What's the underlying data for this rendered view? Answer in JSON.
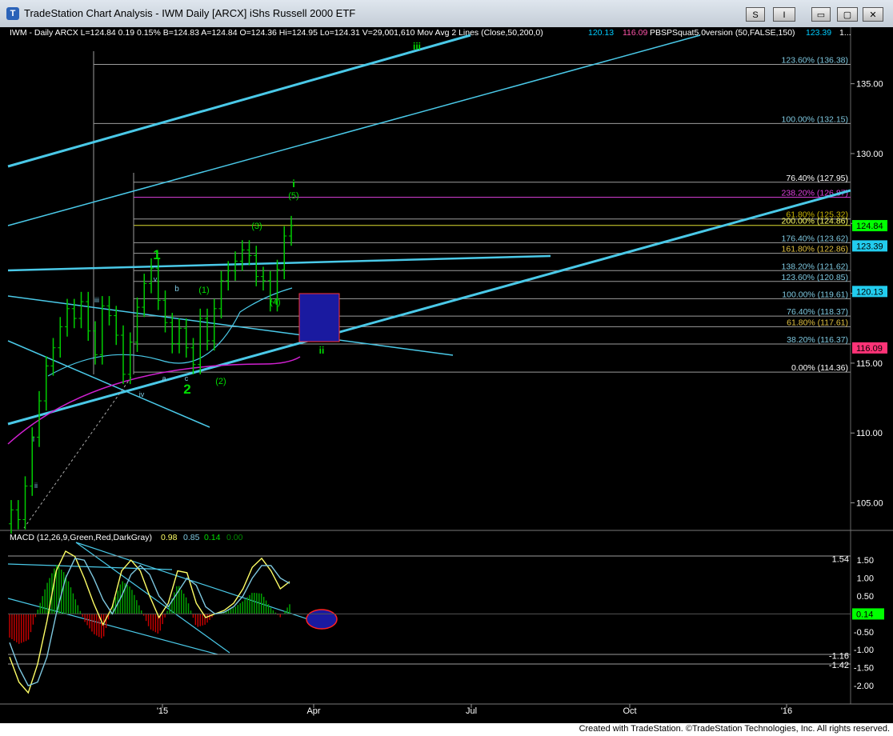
{
  "window": {
    "title": "TradeStation Chart Analysis - IWM Daily [ARCX] iShs Russell 2000 ETF",
    "btn_s": "S",
    "btn_i": "I",
    "btn_min": "▭",
    "btn_max": "▢",
    "btn_close": "✕"
  },
  "colors": {
    "price_up": "#00cc00",
    "channel": "#4ac9e8",
    "macd_hist_pos": "#00aa00",
    "macd_hist_neg": "#cc0000",
    "label_green": "#00dd00",
    "fib_line": "#9c9c9c"
  },
  "header": {
    "text": "IWM - Daily  ARCX  L=124.84  0.19  0.15%  B=124.83  A=124.84  O=124.36  Hi=124.95  Lo=124.31  V=29,001,610  Mov Avg 2 Lines (Close,50,200,0)",
    "ma_val1": "120.13",
    "ma_val2": "116.09",
    "indicator": "PBSPSquat5.0version (50,FALSE,150)",
    "ind_val": "123.39",
    "trail": "1..."
  },
  "chart_data": [
    {
      "type": "line",
      "title": "IWM Daily [ARCX] iShs Russell 2000 ETF",
      "x_ticks": [
        "'15",
        "Apr",
        "Jul",
        "Oct",
        "'16"
      ],
      "y_ticks": [
        "135.00",
        "130.00",
        "125.00",
        "120.00",
        "115.00",
        "110.00",
        "105.00"
      ],
      "ylim": [
        103.2,
        138.3
      ],
      "series": [
        {
          "name": "IWM",
          "style": "bars",
          "values": [
            104.5,
            103.8,
            106.2,
            109.7,
            112.3,
            114.8,
            116.1,
            117.6,
            118.9,
            118.2,
            119.4,
            117.3,
            115.6,
            119.1,
            118.4,
            117.0,
            114.2,
            116.5,
            119.0,
            120.7,
            121.8,
            119.5,
            117.9,
            116.4,
            117.5,
            116.1,
            114.9,
            118.2,
            116.6,
            118.9,
            120.9,
            121.6,
            122.3,
            123.1,
            122.7,
            121.2,
            120.9,
            119.4,
            121.7,
            124.1,
            124.84
          ]
        }
      ],
      "fib_levels": [
        {
          "label": "123.60% (136.38)",
          "value": 136.38
        },
        {
          "label": "100.00% (132.15)",
          "value": 132.15
        },
        {
          "label": "76.40% (127.95)",
          "value": 127.95
        },
        {
          "label": "238.20% (126.87)",
          "value": 126.87
        },
        {
          "label": "61.80% (125.32)",
          "value": 125.32
        },
        {
          "label": "200.00% (124.86)",
          "value": 124.86
        },
        {
          "label": "176.40% (123.62)",
          "value": 123.62
        },
        {
          "label": "161.80% (122.86)",
          "value": 122.86
        },
        {
          "label": "138.20% (121.62)",
          "value": 121.62
        },
        {
          "label": "123.60% (120.85)",
          "value": 120.85
        },
        {
          "label": "100.00% (119.61)",
          "value": 119.61
        },
        {
          "label": "76.40% (118.37)",
          "value": 118.37
        },
        {
          "label": "61.80% (117.61)",
          "value": 117.61
        },
        {
          "label": "38.20% (116.37)",
          "value": 116.37
        },
        {
          "label": "0.00% (114.36)",
          "value": 114.36
        }
      ],
      "wave_labels": [
        "iii",
        "i",
        "(5)",
        "(3)",
        "1",
        "(1)",
        "b",
        "(4)",
        "ii",
        "iii",
        "a",
        "c",
        "2",
        "(2)",
        "iv",
        "ii",
        "i",
        "v"
      ],
      "price_tags": [
        {
          "value": "124.84",
          "bg": "#00ff00"
        },
        {
          "value": "123.39",
          "bg": "#22ccee"
        },
        {
          "value": "120.13",
          "bg": "#22ccee"
        },
        {
          "value": "116.09",
          "bg": "#ff3377"
        }
      ]
    },
    {
      "type": "line",
      "title": "MACD (12,26,9,Green,Red,DarkGray)",
      "values_text": [
        "0.98",
        "0.85",
        "0.14",
        "0.00"
      ],
      "y_ticks": [
        "1.54",
        "1.50",
        "1.00",
        "0.50",
        "0.00",
        "-0.50",
        "-1.00",
        "-1.16",
        "-1.42",
        "-1.50",
        "-2.00"
      ],
      "ylim": [
        -2.4,
        1.95
      ],
      "current_tag": "0.14",
      "series": [
        {
          "name": "MACD",
          "values": [
            -1.2,
            -1.9,
            -2.2,
            -1.4,
            -0.2,
            1.2,
            1.75,
            1.6,
            1.0,
            0.3,
            -0.3,
            0.2,
            1.2,
            1.5,
            1.2,
            0.5,
            -0.1,
            0.3,
            1.2,
            1.15,
            0.3,
            -0.1,
            0.0,
            0.1,
            0.3,
            0.7,
            1.3,
            1.55,
            1.2,
            0.7,
            0.9
          ]
        },
        {
          "name": "Signal",
          "values": [
            -0.8,
            -1.5,
            -2.0,
            -1.9,
            -1.2,
            0.0,
            1.0,
            1.55,
            1.5,
            1.0,
            0.4,
            0.0,
            0.5,
            1.1,
            1.35,
            1.1,
            0.5,
            0.2,
            0.6,
            1.0,
            0.8,
            0.2,
            0.0,
            0.05,
            0.2,
            0.5,
            1.0,
            1.35,
            1.35,
            1.0,
            0.85
          ]
        }
      ]
    }
  ],
  "footer": {
    "text": "Created with TradeStation. ©TradeStation Technologies, Inc. All rights reserved."
  }
}
